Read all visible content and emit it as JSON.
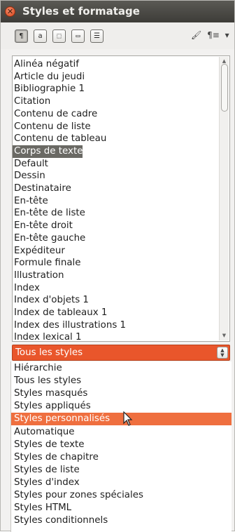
{
  "window": {
    "title": "Styles et formatage",
    "close_glyph": "✕"
  },
  "toolbar": {
    "buttons": [
      {
        "name": "paragraph-styles-button",
        "glyph": "¶",
        "active": true
      },
      {
        "name": "character-styles-button",
        "glyph": "a",
        "active": false
      },
      {
        "name": "frame-styles-button",
        "glyph": "⬚",
        "active": false
      },
      {
        "name": "page-styles-button",
        "glyph": "▭",
        "active": false
      },
      {
        "name": "list-styles-button",
        "glyph": "☰",
        "active": false
      }
    ],
    "fill_format_glyph": "🖌",
    "new_style_glyph": "¶≡",
    "menu_glyph": "▾"
  },
  "style_list": {
    "items": [
      "Alinéa négatif",
      "Article du jeudi",
      "Bibliographie 1",
      "Citation",
      "Contenu de cadre",
      "Contenu de liste",
      "Contenu de tableau",
      "Corps de texte",
      "Default",
      "Dessin",
      "Destinataire",
      "En-tête",
      "En-tête de liste",
      "En-tête droit",
      "En-tête gauche",
      "Expéditeur",
      "Formule finale",
      "Illustration",
      "Index",
      "Index d'objets 1",
      "Index de tableaux 1",
      "Index des illustrations 1",
      "Index lexical 1"
    ],
    "selected_index": 7
  },
  "filter": {
    "value": "Tous les styles",
    "options": [
      "Hiérarchie",
      "Tous les styles",
      "Styles masqués",
      "Styles appliqués",
      "Styles personnalisés",
      "Automatique",
      "Styles de texte",
      "Styles de chapitre",
      "Styles de liste",
      "Styles d'index",
      "Styles pour zones spéciales",
      "Styles HTML",
      "Styles conditionnels"
    ],
    "hover_index": 4
  },
  "colors": {
    "accent": "#e9562b",
    "hover": "#ef6f3f",
    "selection": "#6a6964"
  }
}
